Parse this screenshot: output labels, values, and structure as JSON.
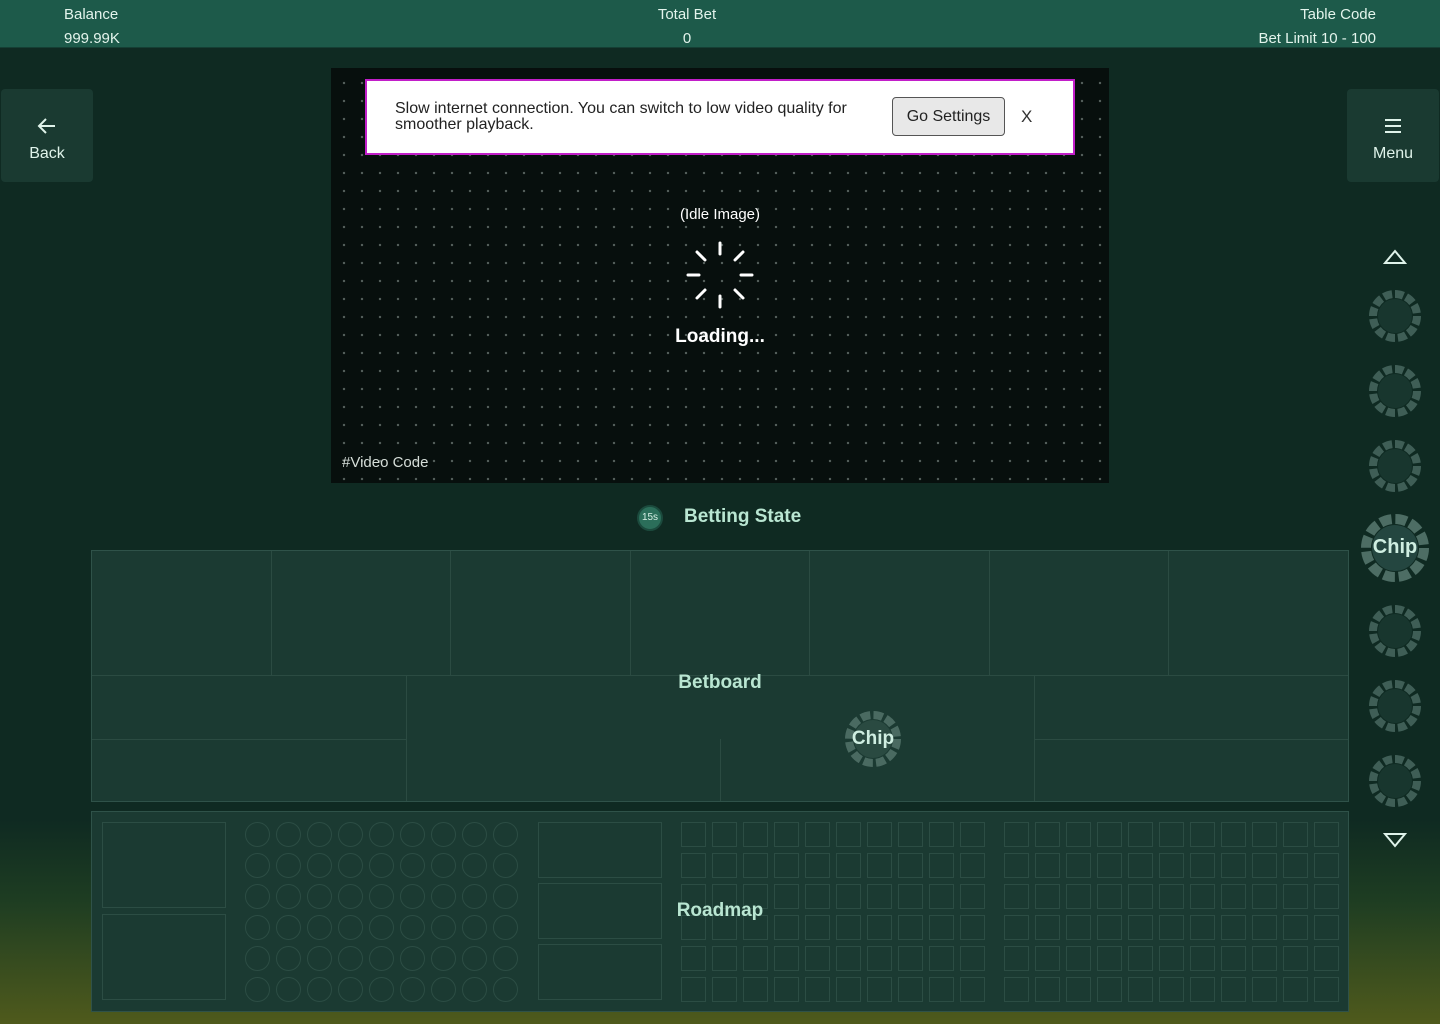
{
  "topbar": {
    "balance_label": "Balance",
    "balance_value": "999.99K",
    "total_bet_label": "Total Bet",
    "total_bet_value": "0",
    "table_code_label": "Table Code",
    "bet_limit": "Bet Limit 10 - 100"
  },
  "nav": {
    "back_label": "Back",
    "menu_label": "Menu"
  },
  "video": {
    "idle_text": "(Idle Image)",
    "loading_text": "Loading...",
    "video_code": "#Video Code"
  },
  "notice": {
    "message": "Slow internet connection. You can switch to low video quality for smoother playback.",
    "button_label": "Go Settings",
    "close_label": "X"
  },
  "betting": {
    "timer": "15s",
    "state_label": "Betting State"
  },
  "betboard": {
    "label": "Betboard",
    "chip_label": "Chip"
  },
  "chips": {
    "selected_label": "Chip"
  },
  "roadmap": {
    "label": "Roadmap"
  },
  "colors": {
    "topbar": "#1d5a4a",
    "panel": "#1b3a32",
    "accent_text": "#b9e6d2",
    "notice_border": "#c21ec9",
    "chip_ring": "#3f5e56"
  }
}
